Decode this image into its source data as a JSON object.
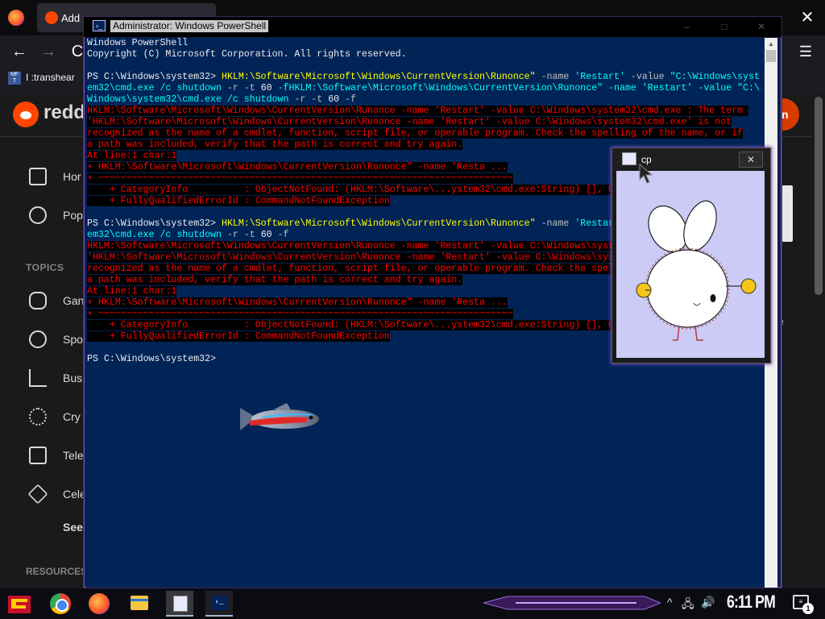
{
  "browser": {
    "tab_title": "Add",
    "bookmark_label": "I :transhear",
    "bookmark_icon_text": "MF T",
    "nav_back": "←",
    "nav_forward": "→",
    "nav_reload": "C",
    "close_glyph": "✕",
    "menu_glyph": "☰"
  },
  "reddit": {
    "wordmark": "redd",
    "join_label": "n",
    "nav_items": [
      {
        "label": "Hor",
        "icon": "home-icon"
      },
      {
        "label": "Pop",
        "icon": "popular-icon"
      }
    ],
    "topics_heading": "TOPICS",
    "topics": [
      {
        "label": "Gan",
        "icon": "gamepad-icon"
      },
      {
        "label": "Spo",
        "icon": "sports-icon"
      },
      {
        "label": "Bus",
        "icon": "chart-icon"
      },
      {
        "label": "Cry",
        "icon": "crypto-icon"
      },
      {
        "label": "Tele",
        "icon": "television-icon"
      },
      {
        "label": "Cele",
        "icon": "star-icon"
      }
    ],
    "see_more": "See",
    "resources_heading": "RESOURCES",
    "right_fragment": "e"
  },
  "powershell": {
    "title": "Administrator: Windows PowerShell",
    "lines": [
      {
        "segments": [
          {
            "t": "Windows PowerShell",
            "c": ""
          }
        ]
      },
      {
        "segments": [
          {
            "t": "Copyright (C) Microsoft Corporation. All rights reserved.",
            "c": ""
          }
        ]
      },
      {
        "segments": [
          {
            "t": "",
            "c": ""
          }
        ]
      },
      {
        "segments": [
          {
            "t": "PS C:\\Windows\\system32> ",
            "c": ""
          },
          {
            "t": "HKLM:\\Software\\Microsoft\\Windows\\CurrentVersion\\Runonce\"",
            "c": "cmd"
          },
          {
            "t": " -name ",
            "c": "op"
          },
          {
            "t": "'Restart'",
            "c": "str"
          },
          {
            "t": " -value ",
            "c": "op"
          },
          {
            "t": "\"C:\\Windows\\syst",
            "c": "str"
          }
        ]
      },
      {
        "segments": [
          {
            "t": "em32\\cmd.exe /c shutdown ",
            "c": "str"
          },
          {
            "t": "-r -t",
            "c": "op"
          },
          {
            "t": " 60 ",
            "c": ""
          },
          {
            "t": "-fHKLM:\\Software\\Microsoft\\Windows\\CurrentVersion\\Runonce\" -name 'Restart' -value \"C:\\",
            "c": "str"
          }
        ]
      },
      {
        "segments": [
          {
            "t": "Windows\\system32\\cmd.exe /c shutdown ",
            "c": "str"
          },
          {
            "t": "-r -t",
            "c": "op"
          },
          {
            "t": " 60 ",
            "c": ""
          },
          {
            "t": "-f",
            "c": "op"
          }
        ]
      },
      {
        "segments": [
          {
            "t": "HKLM:\\Software\\Microsoft\\Windows\\CurrentVersion\\Runonce -name 'Restart' -value C:\\Windows\\system32\\cmd.exe : The term ",
            "c": "err"
          }
        ]
      },
      {
        "segments": [
          {
            "t": "'HKLM:\\Software\\Microsoft\\Windows\\CurrentVersion\\Runonce -name 'Restart' -value C:\\Windows\\system32\\cmd.exe' is not",
            "c": "err"
          }
        ]
      },
      {
        "segments": [
          {
            "t": "recognized as the name of a cmdlet, function, script file, or operable program. Check the spelling of the name, or if",
            "c": "err"
          }
        ]
      },
      {
        "segments": [
          {
            "t": "a path was included, verify that the path is correct and try again.",
            "c": "err"
          }
        ]
      },
      {
        "segments": [
          {
            "t": "At line:1 char:1",
            "c": "err"
          }
        ]
      },
      {
        "segments": [
          {
            "t": "+ HKLM:\\Software\\Microsoft\\Windows\\CurrentVersion\\Runonce\" -name 'Resta ...",
            "c": "err"
          }
        ]
      },
      {
        "segments": [
          {
            "t": "+ ~~~~~~~~~~~~~~~~~~~~~~~~~~~~~~~~~~~~~~~~~~~~~~~~~~~~~~~~~~~~~~~~~~~~~~~~~~",
            "c": "err"
          }
        ]
      },
      {
        "segments": [
          {
            "t": "    + CategoryInfo          : ObjectNotFound: (HKLM:\\Software\\...ystem32\\cmd.exe:String) [], CommandNotFoundException",
            "c": "err"
          }
        ]
      },
      {
        "segments": [
          {
            "t": "    + FullyQualifiedErrorId : CommandNotFoundException",
            "c": "err"
          }
        ]
      },
      {
        "segments": [
          {
            "t": "",
            "c": ""
          }
        ]
      },
      {
        "segments": [
          {
            "t": "PS C:\\Windows\\system32> ",
            "c": ""
          },
          {
            "t": "HKLM:\\Software\\Microsoft\\Windows\\CurrentVersion\\Runonce\"",
            "c": "cmd"
          },
          {
            "t": " -name ",
            "c": "op"
          },
          {
            "t": "'Restart'",
            "c": "str"
          },
          {
            "t": " -value ",
            "c": "op"
          },
          {
            "t": "\"C:\\Windows\\syst",
            "c": "str"
          }
        ]
      },
      {
        "segments": [
          {
            "t": "em32\\cmd.exe /c shutdown ",
            "c": "str"
          },
          {
            "t": "-r -t",
            "c": "op"
          },
          {
            "t": " 60 ",
            "c": ""
          },
          {
            "t": "-f",
            "c": "op"
          }
        ]
      },
      {
        "segments": [
          {
            "t": "HKLM:\\Software\\Microsoft\\Windows\\CurrentVersion\\Runonce -name 'Restart' -value C:\\Windows\\system32\\cmd.exe : The term ",
            "c": "err"
          }
        ]
      },
      {
        "segments": [
          {
            "t": "'HKLM:\\Software\\Microsoft\\Windows\\CurrentVersion\\Runonce -name 'Restart' -value C:\\Windows\\system32\\cmd.exe' is not",
            "c": "err"
          }
        ]
      },
      {
        "segments": [
          {
            "t": "recognized as the name of a cmdlet, function, script file, or operable program. Check the spelling of the name, or if",
            "c": "err"
          }
        ]
      },
      {
        "segments": [
          {
            "t": "a path was included, verify that the path is correct and try again.",
            "c": "err"
          }
        ]
      },
      {
        "segments": [
          {
            "t": "At line:1 char:1",
            "c": "err"
          }
        ]
      },
      {
        "segments": [
          {
            "t": "+ HKLM:\\Software\\Microsoft\\Windows\\CurrentVersion\\Runonce\" -name 'Resta ...",
            "c": "err"
          }
        ]
      },
      {
        "segments": [
          {
            "t": "+ ~~~~~~~~~~~~~~~~~~~~~~~~~~~~~~~~~~~~~~~~~~~~~~~~~~~~~~~~~~~~~~~~~~~~~~~~~~",
            "c": "err"
          }
        ]
      },
      {
        "segments": [
          {
            "t": "    + CategoryInfo          : ObjectNotFound: (HKLM:\\Software\\...ystem32\\cmd.exe:String) [], CommandNotFoundException",
            "c": "err"
          }
        ]
      },
      {
        "segments": [
          {
            "t": "    + FullyQualifiedErrorId : CommandNotFoundException",
            "c": "err"
          }
        ]
      },
      {
        "segments": [
          {
            "t": "",
            "c": ""
          }
        ]
      },
      {
        "segments": [
          {
            "t": "PS C:\\Windows\\system32>",
            "c": ""
          }
        ]
      }
    ]
  },
  "bunny_window": {
    "title": "cp",
    "close_glyph": "✕"
  },
  "taskbar": {
    "clock": "6:11 PM",
    "notification_count": "1",
    "tray_chevron": "^",
    "tray_network": "🖧",
    "tray_volume": "🔊"
  },
  "colors": {
    "ps_background": "#012456",
    "error_fg": "#ff0000",
    "error_bg": "#000000",
    "command": "#ffff00",
    "string": "#00ffff",
    "bunny_bg": "#cbcbf5",
    "reddit_orange": "#ff4500"
  }
}
